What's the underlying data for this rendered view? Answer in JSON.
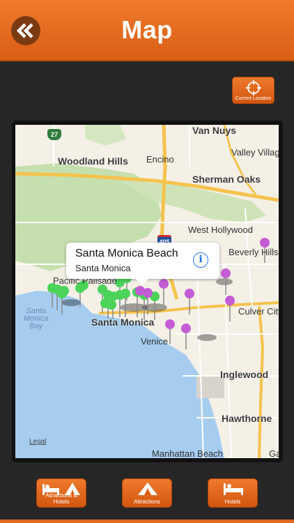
{
  "header": {
    "title": "Map",
    "back_icon": "double-chevron-left-icon"
  },
  "current_location": {
    "label": "Current Location",
    "icon": "crosshair-icon"
  },
  "map": {
    "labels": {
      "van_nuys": "Van Nuys",
      "woodland_hills": "Woodland Hills",
      "encino": "Encino",
      "valley_village": "Valley Villag",
      "sherman_oaks": "Sherman Oaks",
      "west_hollywood": "West Hollywood",
      "beverly_hills": "Beverly Hills",
      "culver_city": "Culver City",
      "pacific_palisades": "Pacific Palisade",
      "santa_monica": "Santa Monica",
      "venice": "Venice",
      "inglewood": "Inglewood",
      "hawthorne": "Hawthorne",
      "manhattan_beach": "Manhattan Beach",
      "santa_monica_bay": "Santa\nMonica\nBay",
      "edge_g": "Ga",
      "legal": "Legal"
    },
    "shields": {
      "route_27": "27",
      "interstate_405": "405"
    },
    "callout": {
      "title": "Santa Monica Beach",
      "subtitle": "Santa Monica",
      "info_icon": "info-icon"
    },
    "colors": {
      "attraction_pin": "#4cd35a",
      "hotel_pin": "#c45cd6"
    }
  },
  "bottom_nav": {
    "attractions_hotels": "Attractions & Hotels",
    "attractions": "Attractions",
    "hotels": "Hotels"
  }
}
